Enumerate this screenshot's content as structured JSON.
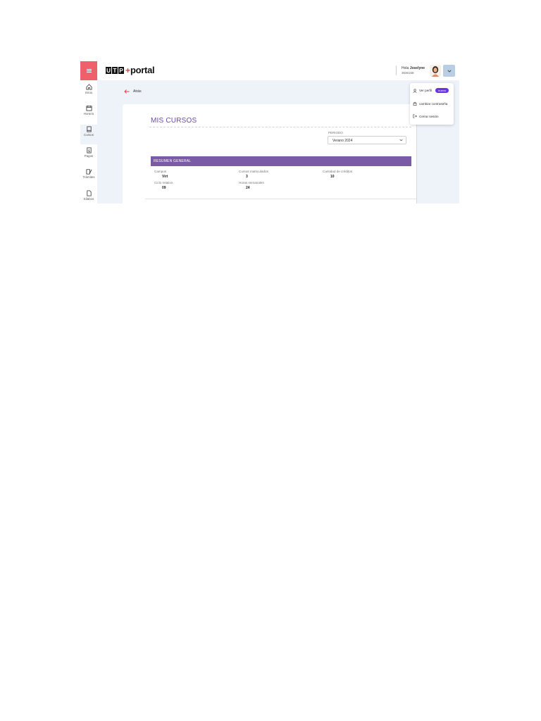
{
  "sidebar": {
    "items": [
      {
        "label": "Inicio",
        "icon": "home-icon"
      },
      {
        "label": "Horario",
        "icon": "calendar-icon"
      },
      {
        "label": "Cursos",
        "icon": "book-icon"
      },
      {
        "label": "Pagos",
        "icon": "dollar-icon"
      },
      {
        "label": "Trámites",
        "icon": "documents-icon"
      },
      {
        "label": "Sílabos",
        "icon": "file-icon"
      }
    ]
  },
  "header": {
    "logo": {
      "letters": [
        "U",
        "T",
        "P"
      ],
      "plus": "+",
      "word": "portal"
    },
    "greeting_prefix": "Hola",
    "user_name": "Joselyne",
    "user_code": "3636158"
  },
  "dropdown": {
    "items": [
      {
        "label": "Ver perfil",
        "badge": "nuevo",
        "icon": "user-icon"
      },
      {
        "label": "cambiar contraseña",
        "icon": "lock-icon"
      },
      {
        "label": "Cerrar sesión",
        "icon": "logout-icon"
      }
    ]
  },
  "back_label": "Atrás",
  "main": {
    "title": "MIS CURSOS",
    "periodo_label": "PERIODO",
    "periodo_value": "Verano 2024",
    "summary_title": "RESUMEN GENERAL",
    "stats": [
      {
        "label": "Campus",
        "value": "Virt"
      },
      {
        "label": "Cursos matriculados",
        "value": "3"
      },
      {
        "label": "Cantidad de créditos",
        "value": "10"
      },
      {
        "label": "Ciclo relativo",
        "value": "09"
      },
      {
        "label": "Horas semanales",
        "value": "24"
      }
    ]
  },
  "colors": {
    "menu_red": "#f0606c",
    "brand_purple": "#7b5aa6",
    "badge_purple": "#6a35e0",
    "back_arrow_red": "#ee3a43",
    "page_bg": "#eef2f9"
  }
}
